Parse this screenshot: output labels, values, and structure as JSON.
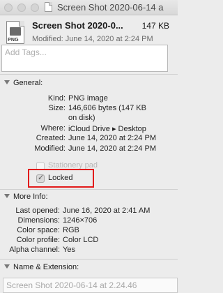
{
  "window": {
    "title": "Screen Shot 2020-06-14 a"
  },
  "header": {
    "name": "Screen Shot 2020-0...",
    "size": "147 KB",
    "modified": "Modified: June 14, 2020 at 2:24 PM",
    "icon_badge": "PNG"
  },
  "tags": {
    "placeholder": "Add Tags..."
  },
  "general": {
    "title": "General:",
    "rows": [
      {
        "label": "Kind:",
        "value": "PNG image"
      },
      {
        "label": "Size:",
        "value": "146,606 bytes (147 KB"
      },
      {
        "label": "",
        "value": "on disk)"
      },
      {
        "label": "Where:",
        "value": "iCloud Drive ▸ Desktop"
      },
      {
        "label": "Created:",
        "value": "June 14, 2020 at 2:24 PM"
      },
      {
        "label": "Modified:",
        "value": "June 14, 2020 at 2:24 PM"
      }
    ],
    "stationery_label": "Stationery pad",
    "locked_label": "Locked",
    "locked_checked": true
  },
  "more_info": {
    "title": "More Info:",
    "rows": [
      {
        "label": "Last opened:",
        "value": "June 16, 2020 at 2:41 AM"
      },
      {
        "label": "Dimensions:",
        "value": "1246×706"
      },
      {
        "label": "Color space:",
        "value": "RGB"
      },
      {
        "label": "Color profile:",
        "value": "Color LCD"
      },
      {
        "label": "Alpha channel:",
        "value": "Yes"
      }
    ]
  },
  "name_ext": {
    "title": "Name & Extension:",
    "value": "Screen Shot 2020-06-14 at 2.24.46"
  },
  "colors": {
    "highlight": "#e21b1b"
  }
}
